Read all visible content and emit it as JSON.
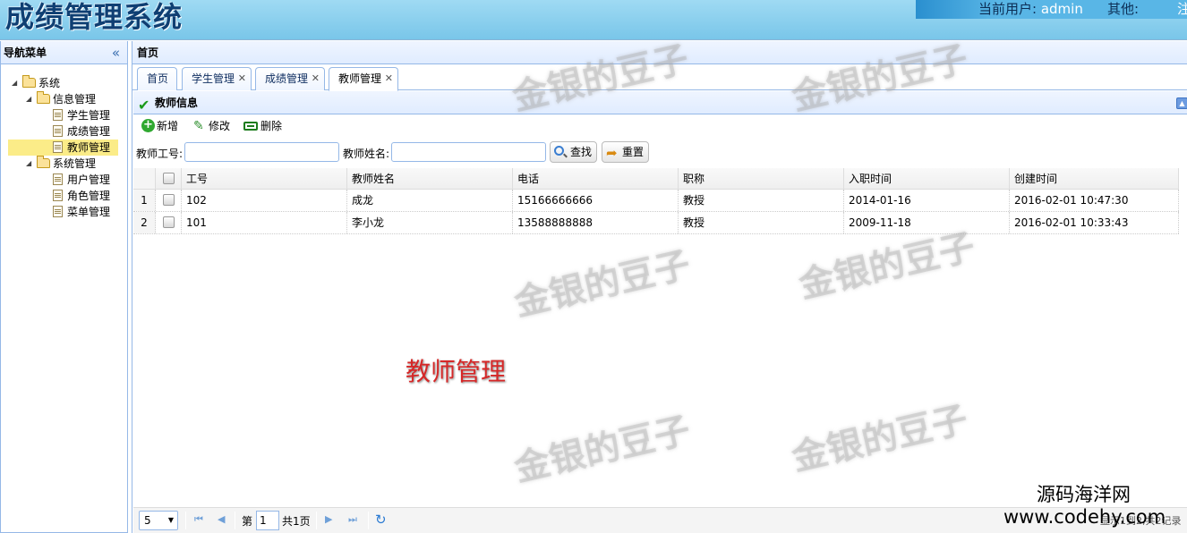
{
  "app": {
    "title": "成绩管理系统",
    "current_user_label": "当前用户:",
    "current_user": "admin",
    "other_label": "其他:",
    "logout": "注"
  },
  "nav": {
    "title": "导航菜单",
    "collapse_icon": "double-chevron-left-icon",
    "tree": {
      "root": "系统",
      "info_group": "信息管理",
      "info_items": [
        "学生管理",
        "成绩管理",
        "教师管理"
      ],
      "sys_group": "系统管理",
      "sys_items": [
        "用户管理",
        "角色管理",
        "菜单管理"
      ],
      "selected": "教师管理"
    }
  },
  "main": {
    "title": "首页",
    "tabs": [
      "首页",
      "学生管理",
      "成绩管理",
      "教师管理"
    ],
    "active_tab": "教师管理"
  },
  "panel": {
    "title": "教师信息",
    "toolbar": {
      "add": "新增",
      "edit": "修改",
      "delete": "删除"
    },
    "search": {
      "id_label": "教师工号:",
      "id_value": "",
      "name_label": "教师姓名:",
      "name_value": "",
      "search_button": "查找",
      "reset_button": "重置"
    }
  },
  "grid": {
    "columns": [
      "工号",
      "教师姓名",
      "电话",
      "职称",
      "入职时间",
      "创建时间"
    ],
    "rows": [
      {
        "num": "1",
        "id": "102",
        "name": "成龙",
        "phone": "15166666666",
        "title": "教授",
        "hire_date": "2014-01-16",
        "created": "2016-02-01 10:47:30"
      },
      {
        "num": "2",
        "id": "101",
        "name": "李小龙",
        "phone": "13588888888",
        "title": "教授",
        "hire_date": "2009-11-18",
        "created": "2016-02-01 10:33:43"
      }
    ]
  },
  "pager": {
    "page_size": "5",
    "page_prefix": "第",
    "page_number": "1",
    "total_pages": "共1页",
    "right_text": "显示1到2,共2记录"
  },
  "overlay": {
    "watermark": "金银的豆子",
    "caption": "教师管理",
    "brand": "源码海洋网",
    "url": "www.codehy.com"
  },
  "colors": {
    "header_bg": "#9fdaf3",
    "panel_border": "#95b8e7",
    "selected_node": "#fbec88",
    "caption_red": "#d62828"
  }
}
